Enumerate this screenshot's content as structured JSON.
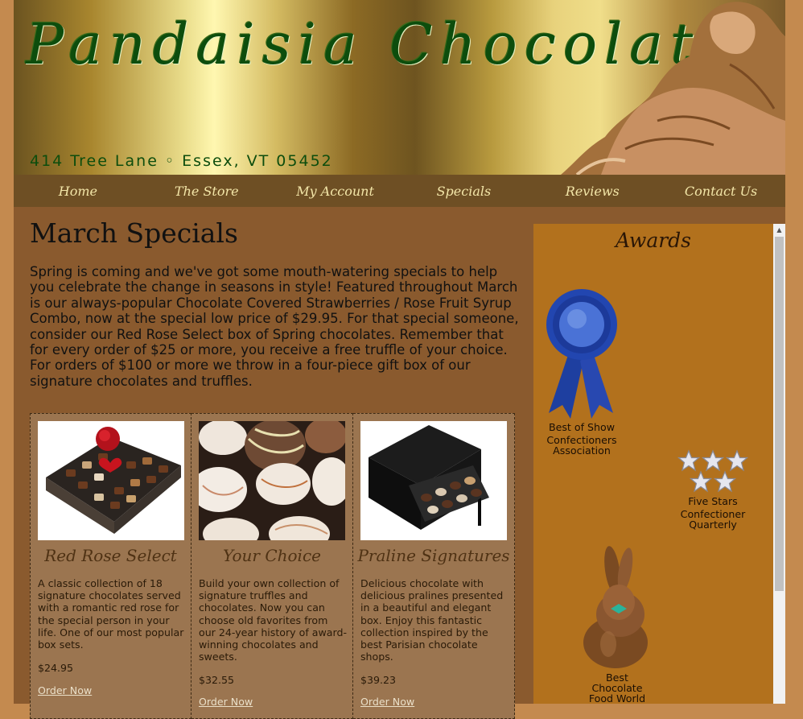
{
  "header": {
    "title": "Pandaisia Chocolates",
    "address": "414 Tree Lane ◦ Essex, VT 05452"
  },
  "nav": {
    "items": [
      {
        "label": "Home"
      },
      {
        "label": "The Store"
      },
      {
        "label": "My Account"
      },
      {
        "label": "Specials"
      },
      {
        "label": "Reviews"
      },
      {
        "label": "Contact Us"
      }
    ]
  },
  "main": {
    "title": "March Specials",
    "intro": "Spring is coming and we've got some mouth-watering specials to help you celebrate the change in seasons in style! Featured throughout March is our always-popular Chocolate Covered Strawberries / Rose Fruit Syrup Combo, now at the special low price of $29.95. For that special someone, consider our Red Rose Select box of Spring chocolates. Remember that for every order of $25 or more, you receive a free truffle of your choice. For orders of $100 or more we throw in a four-piece gift box of our signature chocolates and truffles."
  },
  "products": [
    {
      "name": "Red Rose Select",
      "description": "A classic collection of 18 signature chocolates served with a romantic red rose for the special person in your life. One of our most popular box sets.",
      "price": "$24.95",
      "order_label": "Order Now"
    },
    {
      "name": "Your Choice",
      "description": "Build your own collection of signature truffles and chocolates. Now you can choose old favorites from our 24-year history of award-winning chocolates and sweets.",
      "price": "$32.55",
      "order_label": "Order Now"
    },
    {
      "name": "Praline Signatures",
      "description": "Delicious chocolate with delicious pralines presented in a beautiful and elegant box. Enjoy this fantastic collection inspired by the best Parisian chocolate shops.",
      "price": "$39.23",
      "order_label": "Order Now"
    }
  ],
  "sidebar": {
    "heading": "Awards",
    "awards": [
      {
        "line1": "Best of Show",
        "line2": "Confectioners",
        "line3": "Association",
        "icon": "blue-ribbon-icon"
      },
      {
        "line1": "Five Stars",
        "line2": "Confectioner",
        "line3": "Quarterly",
        "icon": "five-stars-icon"
      },
      {
        "line1": "Best",
        "line2": "Chocolate",
        "line3": "Food World",
        "icon": "chocolate-bunny-icon"
      }
    ]
  },
  "colors": {
    "page_bg": "#c48a4f",
    "content_bg": "#8a5a2e",
    "nav_bg": "#6e4f24",
    "sidebar_bg": "#b2711d",
    "product_bg": "#9b7550",
    "title_green": "#0d4d0d"
  }
}
